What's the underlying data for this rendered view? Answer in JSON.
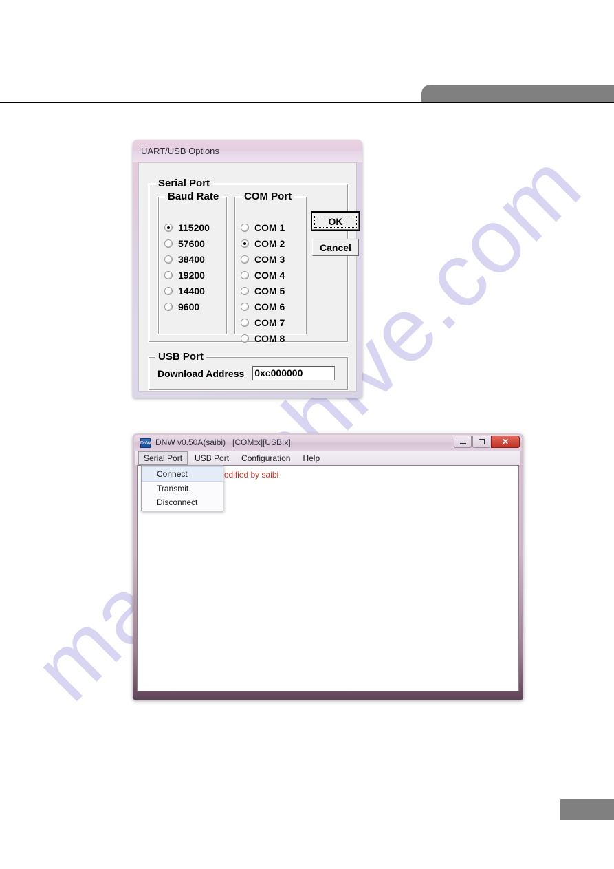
{
  "page": {
    "header_tab": "",
    "footer_tab": "",
    "watermark": "manualshive.com"
  },
  "uart_dialog": {
    "title": "UART/USB Options",
    "serial_port_group": "Serial Port",
    "baud_rate_group": "Baud Rate",
    "com_port_group": "COM Port",
    "usb_port_group": "USB Port",
    "baud_rates": [
      {
        "label": "115200",
        "selected": true
      },
      {
        "label": "57600",
        "selected": false
      },
      {
        "label": "38400",
        "selected": false
      },
      {
        "label": "19200",
        "selected": false
      },
      {
        "label": "14400",
        "selected": false
      },
      {
        "label": "9600",
        "selected": false
      }
    ],
    "com_ports": [
      {
        "label": "COM 1",
        "selected": false
      },
      {
        "label": "COM 2",
        "selected": true
      },
      {
        "label": "COM 3",
        "selected": false
      },
      {
        "label": "COM 4",
        "selected": false
      },
      {
        "label": "COM 5",
        "selected": false
      },
      {
        "label": "COM 6",
        "selected": false
      },
      {
        "label": "COM 7",
        "selected": false
      },
      {
        "label": "COM 8",
        "selected": false
      }
    ],
    "download_address_label": "Download Address",
    "download_address_value": "0xc000000",
    "ok_label": "OK",
    "cancel_label": "Cancel"
  },
  "dnw_window": {
    "app_icon_text": "DNW",
    "title": "DNW v0.50A(saibi)   [COM:x][USB:x]",
    "window_buttons": {
      "minimize": "minimize-icon",
      "maximize": "maximize-icon",
      "close": "✕"
    },
    "menus": [
      {
        "label": "Serial Port",
        "active": true
      },
      {
        "label": "USB Port",
        "active": false
      },
      {
        "label": "Configuration",
        "active": false
      },
      {
        "label": "Help",
        "active": false
      }
    ],
    "serial_port_menu": [
      {
        "label": "Connect",
        "highlight": true
      },
      {
        "label": "Transmit",
        "highlight": false
      },
      {
        "label": "Disconnect",
        "highlight": false
      }
    ],
    "console_text": "eBuffer&GulimFont)-Modified by saibi",
    "console_text_color": "#c0392b"
  }
}
